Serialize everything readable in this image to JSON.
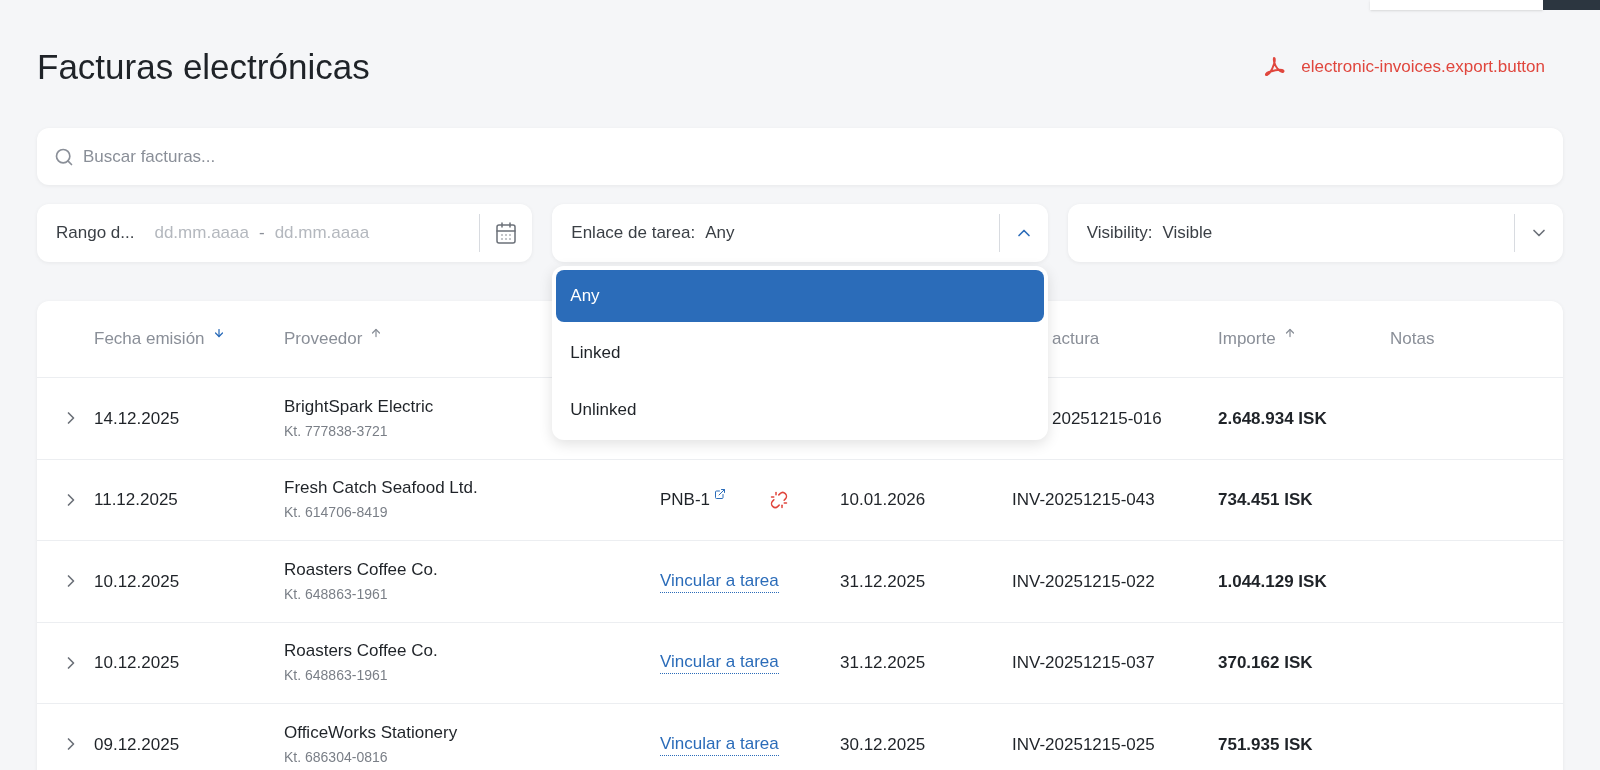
{
  "title": "Facturas electrónicas",
  "export_button": {
    "label": "electronic-invoices.export.button"
  },
  "search": {
    "placeholder": "Buscar facturas..."
  },
  "date_filter": {
    "label": "Rango d...",
    "start_placeholder": "dd.mm.aaaa",
    "separator": "-",
    "end_placeholder": "dd.mm.aaaa"
  },
  "filters": [
    {
      "label": "Enlace de tarea:",
      "value": "Any",
      "expanded": true,
      "options": [
        {
          "label": "Any",
          "selected": true
        },
        {
          "label": "Linked",
          "selected": false
        },
        {
          "label": "Unlinked",
          "selected": false
        }
      ]
    },
    {
      "label": "Visibility:",
      "value": "Visible",
      "expanded": false
    }
  ],
  "table": {
    "columns": [
      {
        "label": "Fecha emisión",
        "sort_arrow": true,
        "descending": true,
        "sort_active": true
      },
      {
        "label": "Proveedor",
        "sort_arrow": true,
        "descending": false,
        "sort_active": false
      },
      {
        "label": "actura"
      },
      {
        "label": "Importe",
        "sort_arrow": true,
        "descending": false,
        "sort_active": false
      },
      {
        "label": "Notas"
      }
    ],
    "rows": [
      {
        "date": "14.12.2025",
        "supplier": "BrightSpark Electric",
        "kt": "Kt. 777838-3721",
        "invoice": "20251215-016",
        "amount": "2.648.934 ISK"
      },
      {
        "date": "11.12.2025",
        "supplier": "Fresh Catch Seafood Ltd.",
        "kt": "Kt. 614706-8419",
        "task": {
          "kind": "linked",
          "label": "PNB-1"
        },
        "due": "10.01.2026",
        "invoice": "INV-20251215-043",
        "amount": "734.451 ISK"
      },
      {
        "date": "10.12.2025",
        "supplier": "Roasters Coffee Co.",
        "kt": "Kt. 648863-1961",
        "task": {
          "kind": "action",
          "label": "Vincular a tarea"
        },
        "due": "31.12.2025",
        "invoice": "INV-20251215-022",
        "amount": "1.044.129 ISK"
      },
      {
        "date": "10.12.2025",
        "supplier": "Roasters Coffee Co.",
        "kt": "Kt. 648863-1961",
        "task": {
          "kind": "action",
          "label": "Vincular a tarea"
        },
        "due": "31.12.2025",
        "invoice": "INV-20251215-037",
        "amount": "370.162 ISK"
      },
      {
        "date": "09.12.2025",
        "supplier": "OfficeWorks Stationery",
        "kt": "Kt. 686304-0816",
        "task": {
          "kind": "action",
          "label": "Vincular a tarea"
        },
        "due": "30.12.2025",
        "invoice": "INV-20251215-025",
        "amount": "751.935 ISK"
      }
    ]
  }
}
